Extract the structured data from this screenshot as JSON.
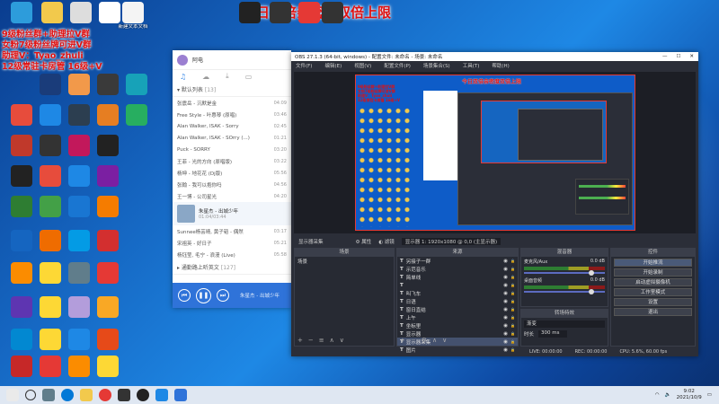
{
  "overlay": {
    "banner": "今日双倍亲密度双倍上限",
    "lines": [
      "9级粉丝群+助理拉V群",
      "女粉7级粉丝牌可进V群",
      "助理V：Tyao_zhuli",
      "12级常驻卡房管 16级+V"
    ]
  },
  "desktop": {
    "top_icons": [
      {
        "label": "",
        "color": "#2d9cdb"
      },
      {
        "label": "",
        "color": "#f2c94c"
      },
      {
        "label": "",
        "color": "#ddd"
      },
      {
        "label": "",
        "color": "#fff"
      },
      {
        "label": "新建文本文档",
        "color": "#f4f4f4"
      },
      {
        "label": "",
        "color": "#222"
      },
      {
        "label": "",
        "color": "#333"
      },
      {
        "label": "",
        "color": "#e53935"
      },
      {
        "label": "",
        "color": "#333"
      }
    ],
    "left_icons": [
      {
        "label": "",
        "color": "#1a3c7a"
      },
      {
        "label": "",
        "color": "#f2994a"
      },
      {
        "label": "",
        "color": "#3a3a3a"
      },
      {
        "label": "",
        "color": "#17a2b8"
      },
      {
        "label": "",
        "color": "#e74c3c"
      },
      {
        "label": "",
        "color": "#1e88e5"
      },
      {
        "label": "",
        "color": "#2c3e50"
      },
      {
        "label": "",
        "color": "#e67e22"
      },
      {
        "label": "",
        "color": "#27ae60"
      },
      {
        "label": "",
        "color": "#c0392b"
      },
      {
        "label": "",
        "color": "#333"
      },
      {
        "label": "",
        "color": "#c2185b"
      },
      {
        "label": "",
        "color": "#222"
      },
      {
        "label": "",
        "color": "#222"
      },
      {
        "label": "",
        "color": "#e74c3c"
      },
      {
        "label": "",
        "color": "#1e88e5"
      },
      {
        "label": "",
        "color": "#7b1fa2"
      },
      {
        "label": "",
        "color": "#2e7d32"
      },
      {
        "label": "",
        "color": "#43a047"
      },
      {
        "label": "",
        "color": "#1976d2"
      },
      {
        "label": "",
        "color": "#f57c00"
      },
      {
        "label": "",
        "color": "#1565c0"
      },
      {
        "label": "",
        "color": "#ef6c00"
      },
      {
        "label": "",
        "color": "#039be5"
      },
      {
        "label": "",
        "color": "#d32f2f"
      },
      {
        "label": "",
        "color": "#fb8c00"
      },
      {
        "label": "",
        "color": "#fdd835"
      },
      {
        "label": "",
        "color": "#607d8b"
      },
      {
        "label": "",
        "color": "#e53935"
      },
      {
        "label": "",
        "color": "#5e35b1"
      },
      {
        "label": "",
        "color": "#fdd835"
      },
      {
        "label": "",
        "color": "#b39ddb"
      },
      {
        "label": "",
        "color": "#f9a825"
      },
      {
        "label": "",
        "color": "#0288d1"
      },
      {
        "label": "",
        "color": "#fdd835"
      },
      {
        "label": "",
        "color": "#1e88e5"
      },
      {
        "label": "",
        "color": "#e64a19"
      },
      {
        "label": "",
        "color": "#c62828"
      },
      {
        "label": "",
        "color": "#e53935"
      },
      {
        "label": "",
        "color": "#fb8c00"
      },
      {
        "label": "",
        "color": "#fdd835"
      }
    ]
  },
  "music": {
    "user": "阿电",
    "section": "默认列表",
    "count": "[13]",
    "songs": [
      {
        "title": "张震岳 - 沉默是金",
        "dur": "04:09"
      },
      {
        "title": "Free Style - 叶惠琴 (原唱)",
        "dur": "03:46"
      },
      {
        "title": "Alan Walker, ISAK - Sorry",
        "dur": "02:45"
      },
      {
        "title": "Alan Walker, ISAK - SOrry (...)",
        "dur": "01:21"
      },
      {
        "title": "Puck - SORRY",
        "dur": "03:20"
      },
      {
        "title": "王菲 - 光的方向 (原唱版)",
        "dur": "03:22"
      },
      {
        "title": "杨坤 - 地花花 (Dj版)",
        "dur": "05:56"
      },
      {
        "title": "张翰 - 我可以抱你吗",
        "dur": "04:56"
      },
      {
        "title": "王一博 - 公司星光",
        "dur": "04:20"
      }
    ],
    "now_playing": {
      "title": "朱星杰 - 出城少年",
      "time": "01:04/03:44"
    },
    "songs_after": [
      {
        "title": "Sunnee杨芸晴, 黄子韬 - 偶然",
        "dur": "03:17"
      },
      {
        "title": "宋祖英 - 好日子",
        "dur": "05:21"
      },
      {
        "title": "杨钰莹, 毛宁 - 浪漫 (Live)",
        "dur": "05:58"
      }
    ],
    "section2": "通勤路上听英文",
    "count2": "[127]",
    "footer_song": "朱星杰 - 出城少年"
  },
  "obs": {
    "title": "OBS 27.1.3 (64-bit, windows) - 配置文件: 未命名 - 场景: 未命名",
    "menus": [
      "文件(F)",
      "编辑(E)",
      "视图(V)",
      "配置文件(P)",
      "场景集合(S)",
      "工具(T)",
      "帮助(H)"
    ],
    "source_bar": [
      "显示器采集",
      "属性",
      "滤镜",
      "显示器 1: 1920x1080 @ 0,0 (主显示器)"
    ],
    "scenes_header": "场景",
    "scene": "场景",
    "sources_header": "来源",
    "sources": [
      "另接子一群",
      "示范音乐",
      "简单线",
      "",
      "叫飞车",
      "日语",
      "窗日直结",
      "上午",
      "坐标里",
      "显示器",
      "显示器采集",
      "图片"
    ],
    "mixer_header": "混音器",
    "mixer": [
      {
        "name": "麦克风/Aux",
        "level": "0.0 dB"
      },
      {
        "name": "桌面音频",
        "level": "0.0 dB"
      }
    ],
    "trans_header": "转场特效",
    "trans_select": "渐变",
    "duration_label": "时长",
    "duration": "300 ms",
    "controls_header": "控件",
    "controls": [
      "开始推流",
      "开始录制",
      "启动虚拟摄像机",
      "工作室模式",
      "设置",
      "退出"
    ],
    "status": [
      "LIVE: 00:00:00",
      "REC: 00:00:00",
      "CPU: 5.6%, 60.00 fps"
    ]
  },
  "taskbar": {
    "time": "9:02",
    "date": "2021/10/9"
  }
}
